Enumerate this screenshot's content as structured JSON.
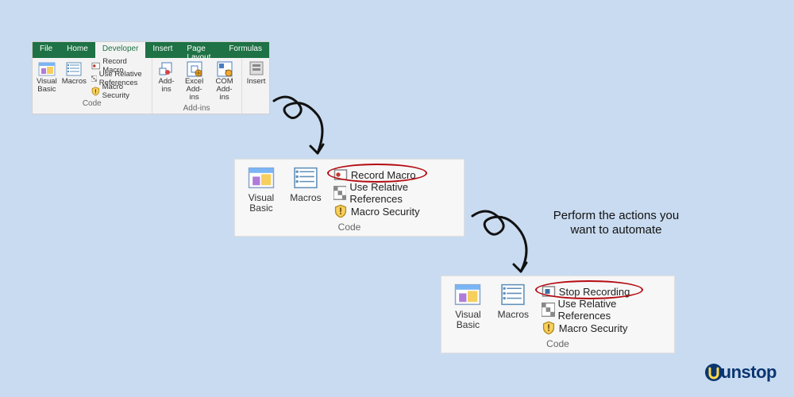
{
  "ribbon": {
    "tabs": [
      "File",
      "Home",
      "Developer",
      "Insert",
      "Page Layout",
      "Formulas"
    ],
    "activeTab": "Developer",
    "groups": {
      "code": {
        "label": "Code",
        "visualBasic": "Visual\nBasic",
        "macros": "Macros",
        "recordMacro": "Record Macro",
        "useRelRef": "Use Relative References",
        "macroSecurity": "Macro Security"
      },
      "addins": {
        "label": "Add-ins",
        "addins": "Add-\nins",
        "excelAddins": "Excel\nAdd-ins",
        "comAddins": "COM\nAdd-ins",
        "insert": "Insert"
      }
    }
  },
  "step2": {
    "visualBasic": "Visual\nBasic",
    "macros": "Macros",
    "recordMacro": "Record Macro",
    "useRelRef": "Use Relative References",
    "macroSecurity": "Macro Security",
    "groupLabel": "Code"
  },
  "step3": {
    "visualBasic": "Visual\nBasic",
    "macros": "Macros",
    "stopRecording": "Stop Recording",
    "useRelRef": "Use Relative References",
    "macroSecurity": "Macro Security",
    "groupLabel": "Code"
  },
  "caption": "Perform the actions you\nwant to automate",
  "brand": "unstop",
  "colors": {
    "ribbonGreen": "#1e7245",
    "highlight": "#b50b12"
  }
}
